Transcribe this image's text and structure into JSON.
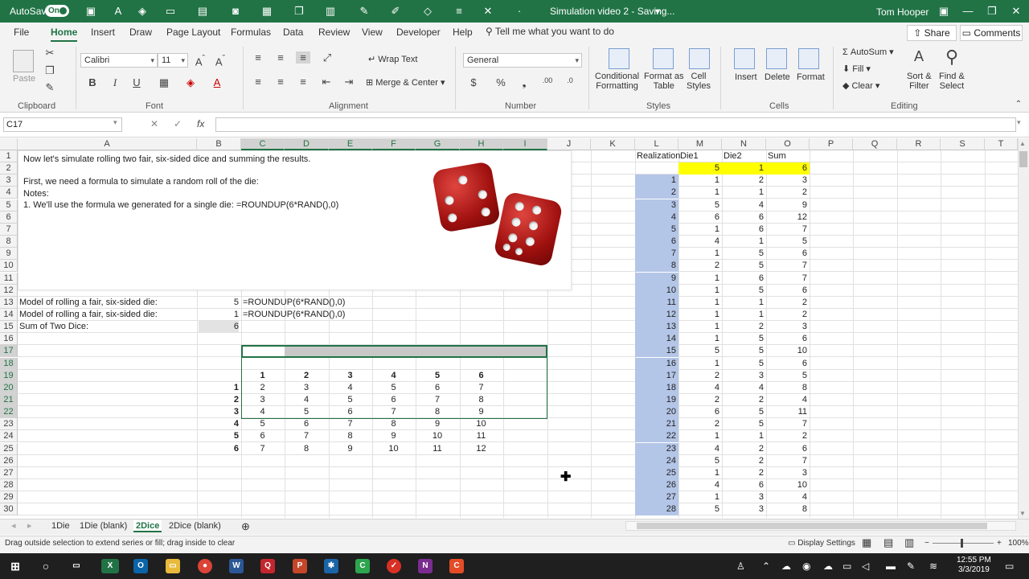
{
  "titlebar": {
    "autosave_label": "AutoSave",
    "autosave_state": "On",
    "document_title": "Simulation video 2  -  Saving...",
    "user": "Tom Hooper"
  },
  "ribbon": {
    "tabs": [
      "File",
      "Home",
      "Insert",
      "Draw",
      "Page Layout",
      "Formulas",
      "Data",
      "Review",
      "View",
      "Developer",
      "Help"
    ],
    "active_tab": "Home",
    "tell_me": "Tell me what you want to do",
    "share": "Share",
    "comments": "Comments",
    "clipboard": {
      "paste": "Paste",
      "label": "Clipboard"
    },
    "font": {
      "name": "Calibri",
      "size": "11",
      "label": "Font"
    },
    "alignment": {
      "wrap": "Wrap Text",
      "merge": "Merge & Center",
      "label": "Alignment"
    },
    "number": {
      "format": "General",
      "label": "Number"
    },
    "styles": {
      "conditional": "Conditional\nFormatting",
      "format_table": "Format as\nTable",
      "cell_styles": "Cell\nStyles",
      "label": "Styles"
    },
    "cells": {
      "insert": "Insert",
      "delete": "Delete",
      "format": "Format",
      "label": "Cells"
    },
    "editing": {
      "autosum": "AutoSum",
      "fill": "Fill",
      "clear": "Clear",
      "sort": "Sort &\nFilter",
      "find": "Find &\nSelect",
      "label": "Editing"
    }
  },
  "formula_bar": {
    "name_box": "C17",
    "fx": "fx",
    "formula": ""
  },
  "columns": [
    "A",
    "B",
    "C",
    "D",
    "E",
    "F",
    "G",
    "H",
    "I",
    "J",
    "K",
    "L",
    "M",
    "N",
    "O",
    "P",
    "Q",
    "R",
    "S",
    "T"
  ],
  "rows": [
    "1",
    "2",
    "3",
    "4",
    "5",
    "6",
    "7",
    "8",
    "9",
    "10",
    "11",
    "12",
    "13",
    "14",
    "15",
    "16",
    "17",
    "18",
    "19",
    "20",
    "21",
    "22",
    "23",
    "24",
    "25",
    "26",
    "27",
    "28",
    "29",
    "30"
  ],
  "textbox": {
    "line1": "Now let's simulate rolling two fair, six-sided dice and summing the results.",
    "line2": "First, we need a formula to simulate a random roll of the die:",
    "line3": "Notes:",
    "line4": "1. We'll use the formula we generated for a single die:  =ROUNDUP(6*RAND(),0)"
  },
  "model": {
    "r13_label": "Model of rolling a fair, six-sided die:",
    "r13_value": "5",
    "r13_formula": "=ROUNDUP(6*RAND(),0)",
    "r14_label": "Model of rolling a fair, six-sided die:",
    "r14_value": "1",
    "r14_formula": "=ROUNDUP(6*RAND(),0)",
    "r15_label": "Sum of Two Dice:",
    "r15_value": "6"
  },
  "sum_table": {
    "header": [
      "1",
      "2",
      "3",
      "4",
      "5",
      "6"
    ],
    "row_labels": [
      "1",
      "2",
      "3",
      "4",
      "5",
      "6"
    ],
    "rows": [
      [
        "2",
        "3",
        "4",
        "5",
        "6",
        "7"
      ],
      [
        "3",
        "4",
        "5",
        "6",
        "7",
        "8"
      ],
      [
        "4",
        "5",
        "6",
        "7",
        "8",
        "9"
      ],
      [
        "5",
        "6",
        "7",
        "8",
        "9",
        "10"
      ],
      [
        "6",
        "7",
        "8",
        "9",
        "10",
        "11"
      ],
      [
        "7",
        "8",
        "9",
        "10",
        "11",
        "12"
      ]
    ]
  },
  "sim": {
    "headers": [
      "Realization",
      "Die1",
      "Die2",
      "Sum"
    ],
    "current": [
      "5",
      "1",
      "6"
    ],
    "rows": [
      [
        "1",
        "1",
        "2",
        "3"
      ],
      [
        "2",
        "1",
        "1",
        "2"
      ],
      [
        "3",
        "5",
        "4",
        "9"
      ],
      [
        "4",
        "6",
        "6",
        "12"
      ],
      [
        "5",
        "1",
        "6",
        "7"
      ],
      [
        "6",
        "4",
        "1",
        "5"
      ],
      [
        "7",
        "1",
        "5",
        "6"
      ],
      [
        "8",
        "2",
        "5",
        "7"
      ],
      [
        "9",
        "1",
        "6",
        "7"
      ],
      [
        "10",
        "1",
        "5",
        "6"
      ],
      [
        "11",
        "1",
        "1",
        "2"
      ],
      [
        "12",
        "1",
        "1",
        "2"
      ],
      [
        "13",
        "1",
        "2",
        "3"
      ],
      [
        "14",
        "1",
        "5",
        "6"
      ],
      [
        "15",
        "5",
        "5",
        "10"
      ],
      [
        "16",
        "1",
        "5",
        "6"
      ],
      [
        "17",
        "2",
        "3",
        "5"
      ],
      [
        "18",
        "4",
        "4",
        "8"
      ],
      [
        "19",
        "2",
        "2",
        "4"
      ],
      [
        "20",
        "6",
        "5",
        "11"
      ],
      [
        "21",
        "2",
        "5",
        "7"
      ],
      [
        "22",
        "1",
        "1",
        "2"
      ],
      [
        "23",
        "4",
        "2",
        "6"
      ],
      [
        "24",
        "5",
        "2",
        "7"
      ],
      [
        "25",
        "1",
        "2",
        "3"
      ],
      [
        "26",
        "4",
        "6",
        "10"
      ],
      [
        "27",
        "1",
        "3",
        "4"
      ],
      [
        "28",
        "5",
        "3",
        "8"
      ]
    ]
  },
  "sheets": [
    "1Die",
    "1Die (blank)",
    "2Dice",
    "2Dice (blank)"
  ],
  "active_sheet": "2Dice",
  "status": {
    "message": "Drag outside selection to extend series or fill; drag inside to clear",
    "display_settings": "Display Settings",
    "zoom": "100%"
  },
  "taskbar": {
    "time": "12:55 PM",
    "date": "3/3/2019"
  },
  "colors": {
    "excel_green": "#217346",
    "realization_blue": "#b4c6e7",
    "highlight_yellow": "#ffff00"
  }
}
